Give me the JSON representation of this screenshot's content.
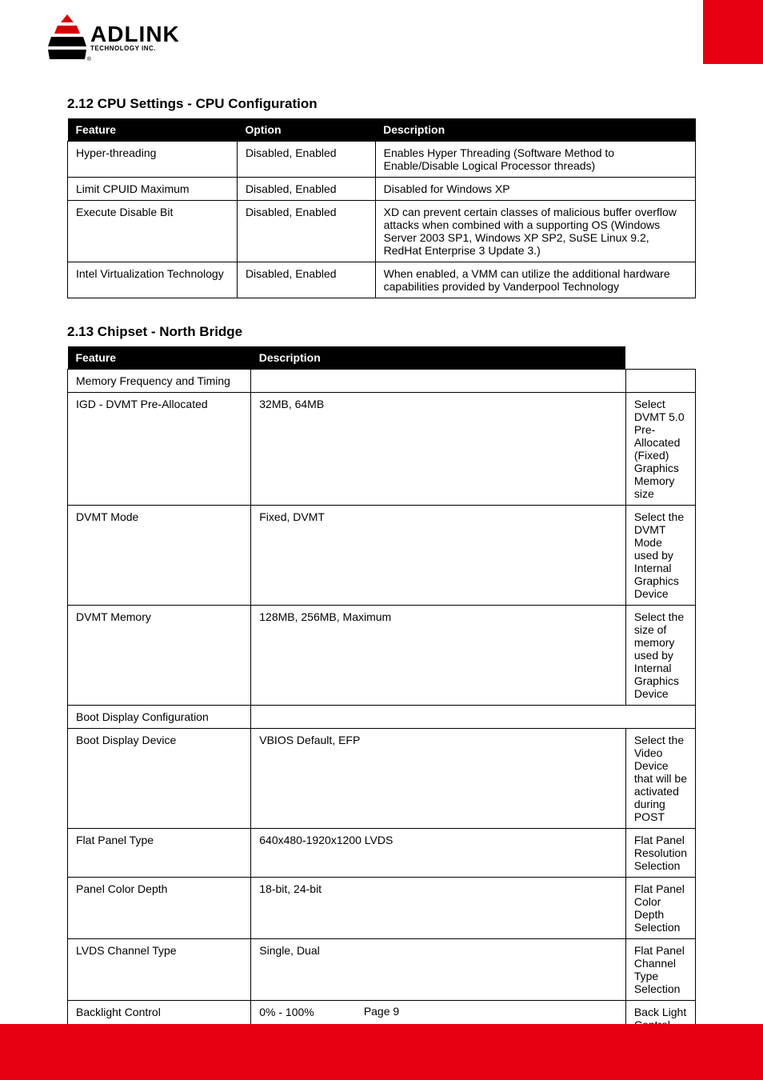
{
  "logo": {
    "main": "ADLINK",
    "sub": "TECHNOLOGY INC."
  },
  "section1": {
    "title": "2.12 CPU Settings - CPU Configuration",
    "header": [
      "Feature",
      "Option",
      "Description"
    ],
    "rows": [
      [
        "Hyper-threading",
        "Disabled, Enabled",
        "Enables Hyper Threading (Software Method to Enable/Disable Logical Processor threads)"
      ],
      [
        "Limit CPUID Maximum",
        "Disabled, Enabled",
        "Disabled for Windows XP"
      ],
      [
        "Execute Disable Bit",
        "Disabled, Enabled",
        "XD can prevent certain classes of malicious buffer overflow attacks when combined with a supporting OS (Windows Server 2003 SP1, Windows XP SP2, SuSE Linux 9.2, RedHat Enterprise 3 Update 3.)"
      ],
      [
        "Intel Virtualization Technology",
        "Disabled, Enabled",
        "When enabled, a VMM can utilize the additional hardware capabilities provided by Vanderpool Technology"
      ]
    ]
  },
  "section2": {
    "title": "2.13 Chipset - North Bridge",
    "header": [
      "Feature",
      "Description"
    ],
    "rows": [
      [
        "Memory Frequency and Timing",
        "",
        ""
      ],
      [
        "IGD - DVMT Pre-Allocated",
        "32MB, 64MB",
        "Select DVMT 5.0 Pre-Allocated (Fixed) Graphics Memory size"
      ],
      [
        "DVMT Mode",
        "Fixed, DVMT",
        "Select the DVMT Mode used by Internal Graphics Device"
      ],
      [
        "DVMT Memory",
        "128MB, 256MB, Maximum",
        "Select the size of memory used by Internal Graphics Device"
      ],
      [
        "Boot Display Configuration",
        {
          "colspan": 2,
          "text": ""
        }
      ],
      [
        "Boot Display Device",
        "VBIOS Default, EFP",
        "Select the Video Device that will be activated during POST"
      ],
      [
        "Flat Panel Type",
        "640x480-1920x1200 LVDS",
        "Flat Panel Resolution Selection"
      ],
      [
        "Panel Color Depth",
        "18-bit, 24-bit",
        "Flat Panel Color Depth Selection"
      ],
      [
        "LVDS Channel Type",
        "Single, Dual",
        "Flat Panel Channel Type Selection"
      ],
      [
        "Backlight Control",
        "0% - 100%",
        "Back Light Control Setting"
      ]
    ]
  },
  "footer": {
    "text": "Page 9"
  }
}
